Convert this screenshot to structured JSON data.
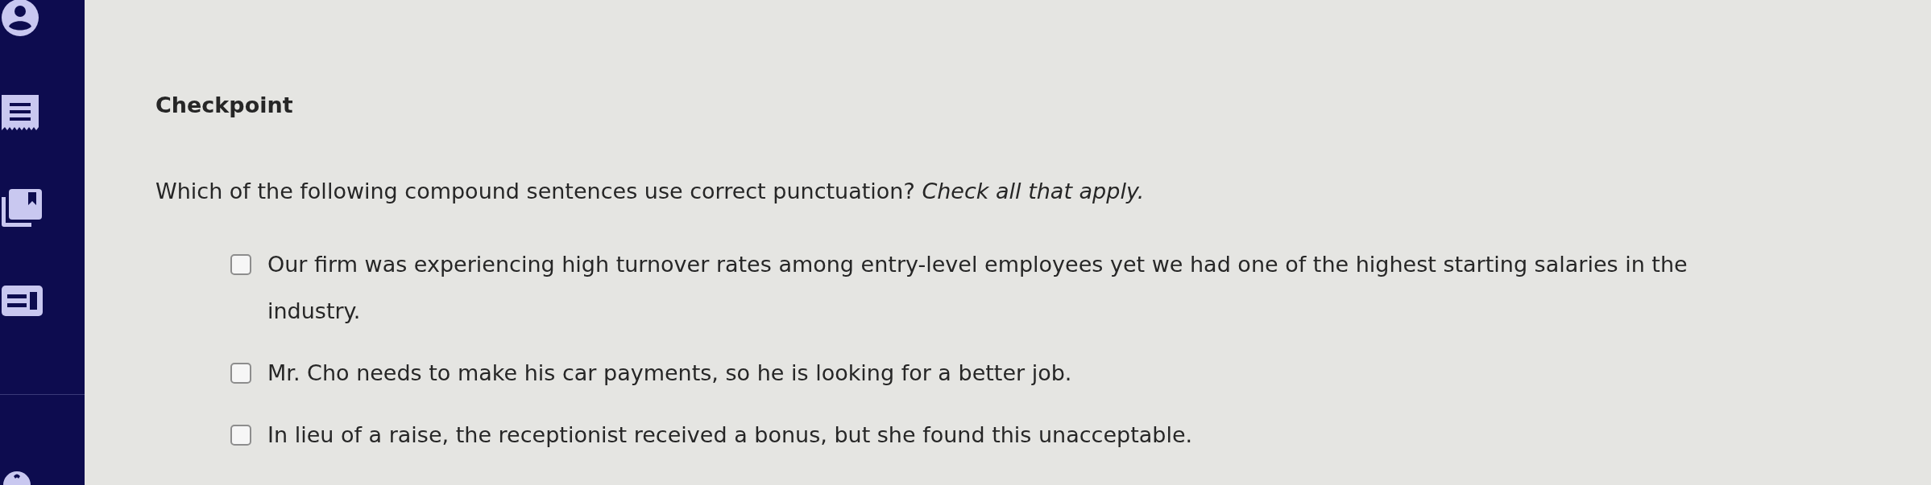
{
  "title": "Checkpoint",
  "question": {
    "text": "Which of the following compound sentences use correct punctuation? *Check all that apply.*"
  },
  "options": [
    {
      "text": "Our firm was experiencing high turnover rates among entry-level employees yet we had one of the highest starting salaries in the industry.",
      "checked": false
    },
    {
      "text": "Mr. Cho needs to make his car payments, so he is looking for a better job.",
      "checked": false
    },
    {
      "text": "In lieu of a raise, the receptionist received a bonus, but she found this unacceptable.",
      "checked": false
    }
  ]
}
